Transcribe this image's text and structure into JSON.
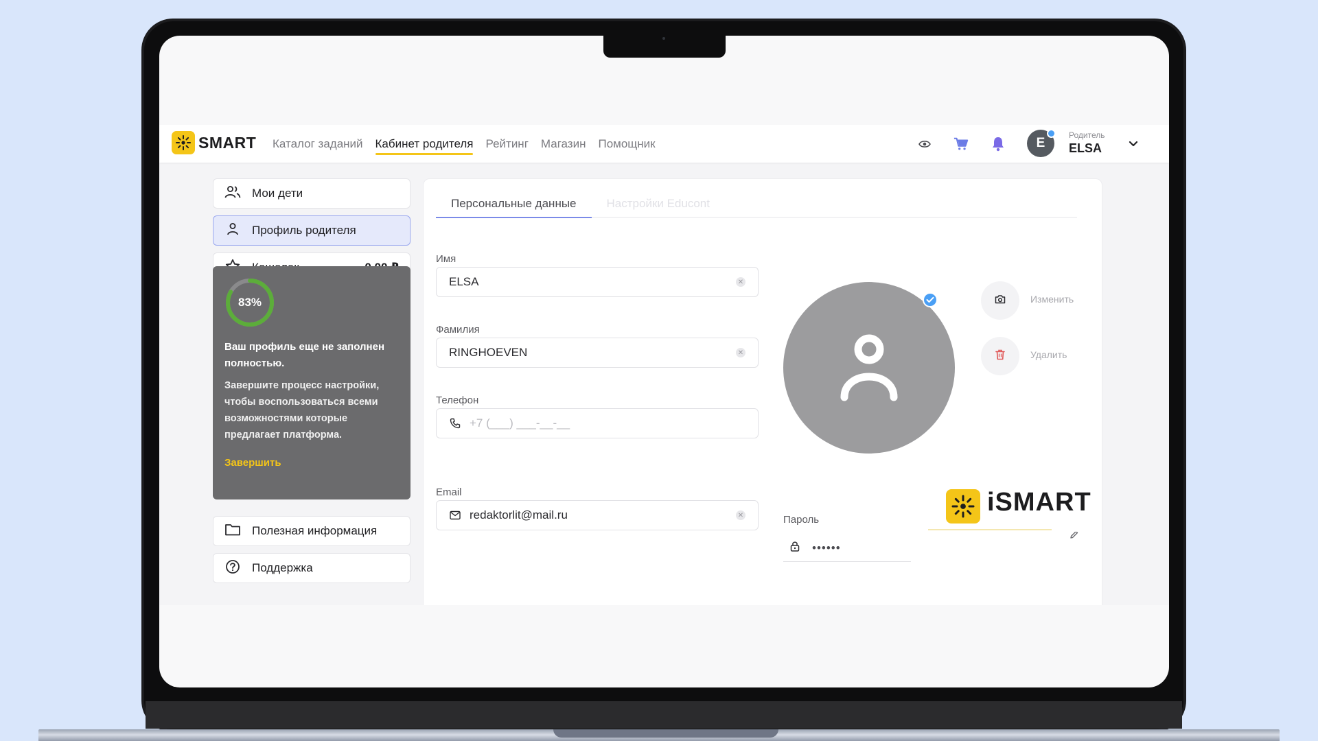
{
  "brand": {
    "name": "SMART",
    "tile_name": "iSMART",
    "accent": "#f4c518"
  },
  "nav": {
    "items": [
      {
        "label": "Каталог заданий",
        "active": false
      },
      {
        "label": "Кабинет родителя",
        "active": true
      },
      {
        "label": "Рейтинг",
        "active": false
      },
      {
        "label": "Магазин",
        "active": false
      },
      {
        "label": "Помощник",
        "active": false
      }
    ]
  },
  "header_icons": [
    "eye-icon",
    "cart-icon",
    "bell-icon"
  ],
  "user": {
    "initial": "E",
    "role": "Родитель",
    "name": "ELSA"
  },
  "sidebar": {
    "items": [
      {
        "label": "Мои дети",
        "icon": "users-icon",
        "active": false
      },
      {
        "label": "Профиль родителя",
        "icon": "user-icon",
        "active": true
      },
      {
        "label": "Кошелек",
        "icon": "star-icon",
        "amount": "0,00 ₽",
        "active": false
      }
    ],
    "bottom_items": [
      {
        "label": "Полезная информация",
        "icon": "folder-icon"
      },
      {
        "label": "Поддержка",
        "icon": "help-icon"
      }
    ]
  },
  "promo": {
    "progress_percent": 83,
    "progress_label": "83%",
    "title": "Ваш профиль еще не заполнен полностью.",
    "text": "Завершите процесс настройки, чтобы воспользоваться всеми возможностями которые предлагает платформа.",
    "link": "Завершить"
  },
  "tabs": [
    {
      "label": "Персональные данные",
      "active": true
    },
    {
      "label": "Настройки Educont",
      "active": false
    }
  ],
  "form": {
    "first_name": {
      "label": "Имя",
      "value": "ELSA"
    },
    "last_name": {
      "label": "Фамилия",
      "value": "RINGHOEVEN"
    },
    "phone": {
      "label": "Телефон",
      "placeholder": "+7 (___) ___-__-__"
    },
    "email": {
      "label": "Email",
      "value": "redaktorlit@mail.ru"
    },
    "password": {
      "label": "Пароль",
      "value": "••••••"
    }
  },
  "photo_actions": {
    "change": "Изменить",
    "delete": "Удалить"
  },
  "colors": {
    "active_tab_underline": "#7b8ae8",
    "verified_badge": "#4a9ff5",
    "delete_red": "#e05656"
  }
}
